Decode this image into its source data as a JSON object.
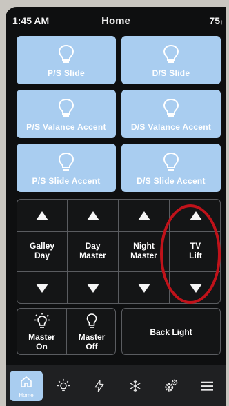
{
  "status": {
    "time": "1:45 AM",
    "title": "Home",
    "temperature": "75"
  },
  "tiles": [
    {
      "label": "P/S Slide"
    },
    {
      "label": "D/S Slide"
    },
    {
      "label": "P/S Valance Accent"
    },
    {
      "label": "D/S Valance Accent"
    },
    {
      "label": "P/S Slide Accent"
    },
    {
      "label": "D/S Slide Accent"
    }
  ],
  "lifts": [
    {
      "line1": "Galley",
      "line2": "Day"
    },
    {
      "line1": "Day",
      "line2": "Master"
    },
    {
      "line1": "Night",
      "line2": "Master"
    },
    {
      "line1": "TV",
      "line2": "Lift"
    }
  ],
  "master": {
    "on": {
      "line1": "Master",
      "line2": "On"
    },
    "off": {
      "line1": "Master",
      "line2": "Off"
    }
  },
  "backlight": {
    "label": "Back Light"
  },
  "nav": {
    "home_label": "Home"
  },
  "colors": {
    "tile": "#a9cdf0",
    "annotation": "#c0121a",
    "background": "#0e0f10"
  }
}
